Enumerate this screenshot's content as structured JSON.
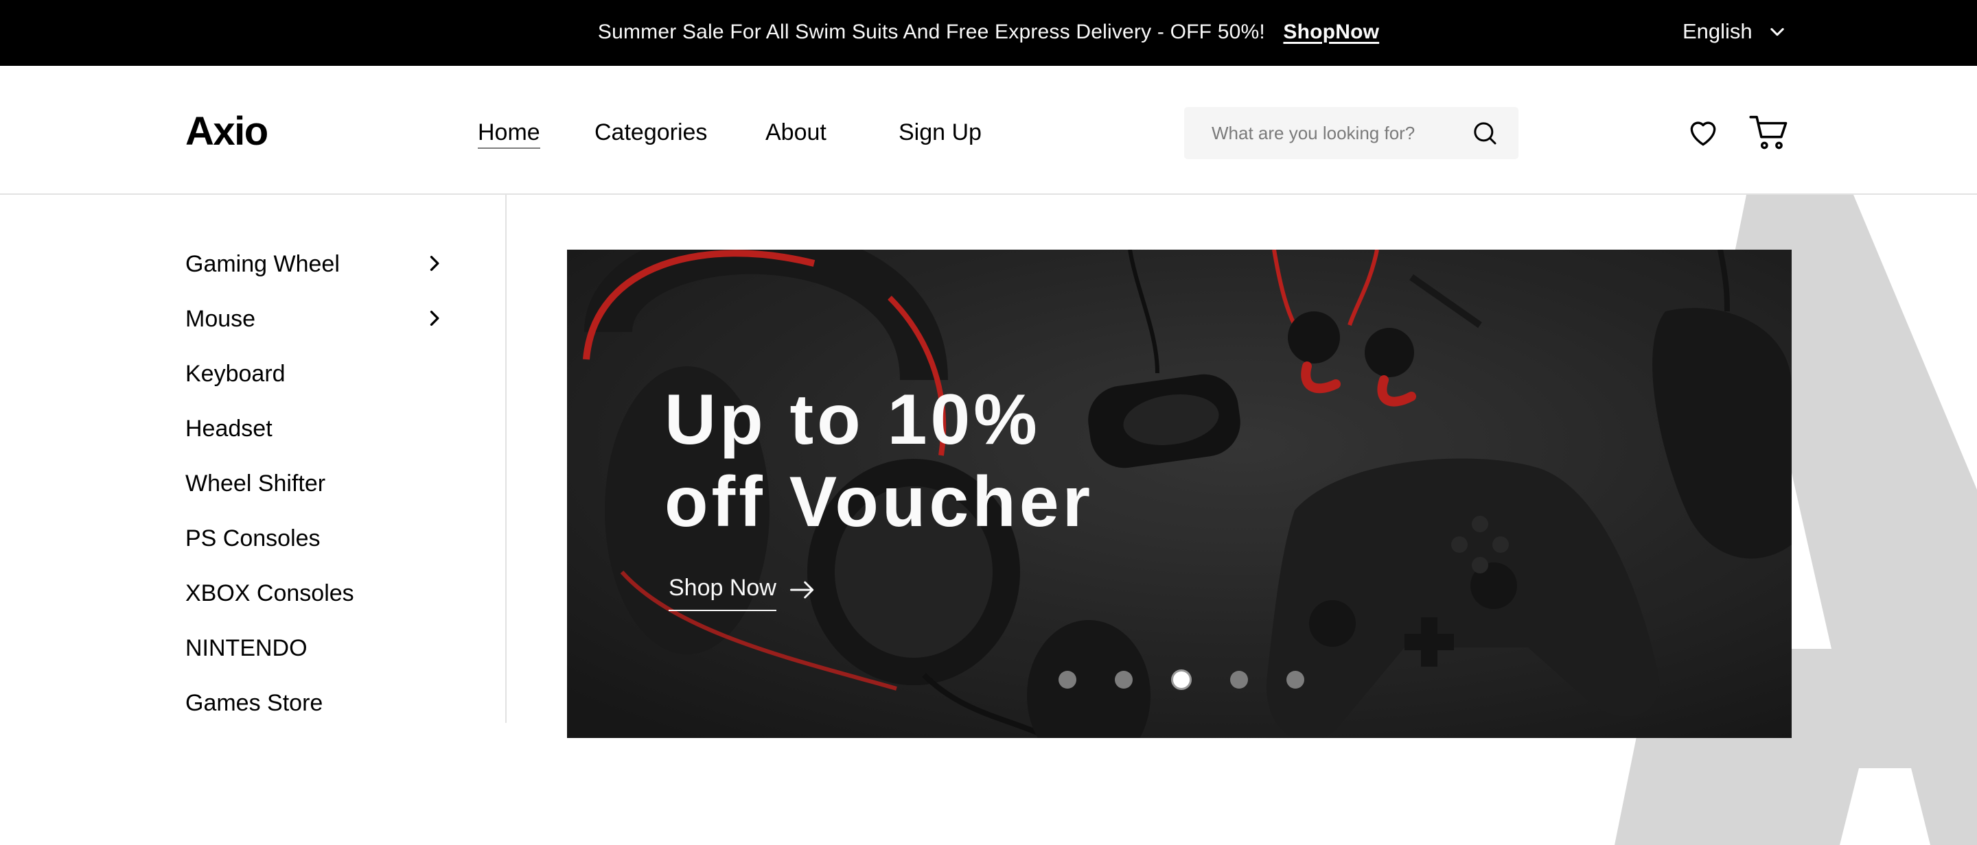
{
  "promo": {
    "message": "Summer Sale For All Swim Suits And Free Express Delivery - OFF 50%!",
    "link_label": "ShopNow"
  },
  "language": {
    "selected": "English",
    "icon": "chevron-down-icon"
  },
  "header": {
    "logo": "Axio",
    "nav": [
      "Home",
      "Categories",
      "About",
      "Sign Up"
    ],
    "active_nav": "Home",
    "search_placeholder": "What are you looking for?",
    "icons": [
      "search-icon",
      "heart-icon",
      "cart-icon"
    ]
  },
  "sidebar": {
    "categories": [
      {
        "label": "Gaming Wheel",
        "has_submenu": true
      },
      {
        "label": "Mouse",
        "has_submenu": true
      },
      {
        "label": "Keyboard",
        "has_submenu": false
      },
      {
        "label": "Headset",
        "has_submenu": false
      },
      {
        "label": "Wheel Shifter",
        "has_submenu": false
      },
      {
        "label": "PS Consoles",
        "has_submenu": false
      },
      {
        "label": "XBOX Consoles",
        "has_submenu": false
      },
      {
        "label": "NINTENDO",
        "has_submenu": false
      },
      {
        "label": "Games Store",
        "has_submenu": false
      }
    ]
  },
  "banner": {
    "headline_line1": "Up to 10%",
    "headline_line2": "off Voucher",
    "cta_label": "Shop Now",
    "slides_total": 5,
    "active_slide": 3
  },
  "colors": {
    "topbar_bg": "#000000",
    "text_light": "#fafafa",
    "banner_bg": "#232323",
    "search_bg": "#f5f5f5",
    "accent_red": "#c8231f",
    "dot_inactive": "#7d7d7d",
    "bg_letter": "#d6d6d6"
  }
}
